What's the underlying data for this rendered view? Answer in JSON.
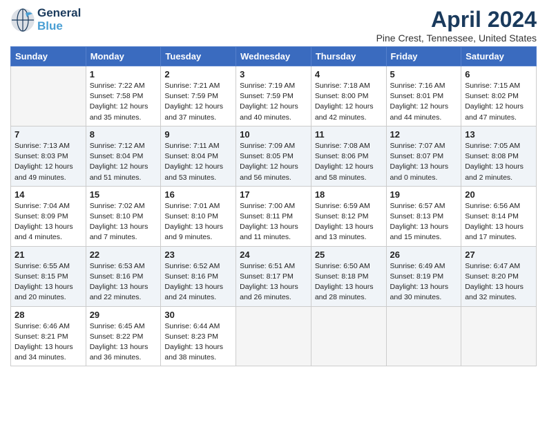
{
  "header": {
    "logo_general": "General",
    "logo_blue": "Blue",
    "month_title": "April 2024",
    "location": "Pine Crest, Tennessee, United States"
  },
  "weekdays": [
    "Sunday",
    "Monday",
    "Tuesday",
    "Wednesday",
    "Thursday",
    "Friday",
    "Saturday"
  ],
  "weeks": [
    [
      {
        "day": "",
        "empty": true
      },
      {
        "day": "1",
        "sunrise": "7:22 AM",
        "sunset": "7:58 PM",
        "daylight": "12 hours and 35 minutes."
      },
      {
        "day": "2",
        "sunrise": "7:21 AM",
        "sunset": "7:59 PM",
        "daylight": "12 hours and 37 minutes."
      },
      {
        "day": "3",
        "sunrise": "7:19 AM",
        "sunset": "7:59 PM",
        "daylight": "12 hours and 40 minutes."
      },
      {
        "day": "4",
        "sunrise": "7:18 AM",
        "sunset": "8:00 PM",
        "daylight": "12 hours and 42 minutes."
      },
      {
        "day": "5",
        "sunrise": "7:16 AM",
        "sunset": "8:01 PM",
        "daylight": "12 hours and 44 minutes."
      },
      {
        "day": "6",
        "sunrise": "7:15 AM",
        "sunset": "8:02 PM",
        "daylight": "12 hours and 47 minutes."
      }
    ],
    [
      {
        "day": "7",
        "sunrise": "7:13 AM",
        "sunset": "8:03 PM",
        "daylight": "12 hours and 49 minutes."
      },
      {
        "day": "8",
        "sunrise": "7:12 AM",
        "sunset": "8:04 PM",
        "daylight": "12 hours and 51 minutes."
      },
      {
        "day": "9",
        "sunrise": "7:11 AM",
        "sunset": "8:04 PM",
        "daylight": "12 hours and 53 minutes."
      },
      {
        "day": "10",
        "sunrise": "7:09 AM",
        "sunset": "8:05 PM",
        "daylight": "12 hours and 56 minutes."
      },
      {
        "day": "11",
        "sunrise": "7:08 AM",
        "sunset": "8:06 PM",
        "daylight": "12 hours and 58 minutes."
      },
      {
        "day": "12",
        "sunrise": "7:07 AM",
        "sunset": "8:07 PM",
        "daylight": "13 hours and 0 minutes."
      },
      {
        "day": "13",
        "sunrise": "7:05 AM",
        "sunset": "8:08 PM",
        "daylight": "13 hours and 2 minutes."
      }
    ],
    [
      {
        "day": "14",
        "sunrise": "7:04 AM",
        "sunset": "8:09 PM",
        "daylight": "13 hours and 4 minutes."
      },
      {
        "day": "15",
        "sunrise": "7:02 AM",
        "sunset": "8:10 PM",
        "daylight": "13 hours and 7 minutes."
      },
      {
        "day": "16",
        "sunrise": "7:01 AM",
        "sunset": "8:10 PM",
        "daylight": "13 hours and 9 minutes."
      },
      {
        "day": "17",
        "sunrise": "7:00 AM",
        "sunset": "8:11 PM",
        "daylight": "13 hours and 11 minutes."
      },
      {
        "day": "18",
        "sunrise": "6:59 AM",
        "sunset": "8:12 PM",
        "daylight": "13 hours and 13 minutes."
      },
      {
        "day": "19",
        "sunrise": "6:57 AM",
        "sunset": "8:13 PM",
        "daylight": "13 hours and 15 minutes."
      },
      {
        "day": "20",
        "sunrise": "6:56 AM",
        "sunset": "8:14 PM",
        "daylight": "13 hours and 17 minutes."
      }
    ],
    [
      {
        "day": "21",
        "sunrise": "6:55 AM",
        "sunset": "8:15 PM",
        "daylight": "13 hours and 20 minutes."
      },
      {
        "day": "22",
        "sunrise": "6:53 AM",
        "sunset": "8:16 PM",
        "daylight": "13 hours and 22 minutes."
      },
      {
        "day": "23",
        "sunrise": "6:52 AM",
        "sunset": "8:16 PM",
        "daylight": "13 hours and 24 minutes."
      },
      {
        "day": "24",
        "sunrise": "6:51 AM",
        "sunset": "8:17 PM",
        "daylight": "13 hours and 26 minutes."
      },
      {
        "day": "25",
        "sunrise": "6:50 AM",
        "sunset": "8:18 PM",
        "daylight": "13 hours and 28 minutes."
      },
      {
        "day": "26",
        "sunrise": "6:49 AM",
        "sunset": "8:19 PM",
        "daylight": "13 hours and 30 minutes."
      },
      {
        "day": "27",
        "sunrise": "6:47 AM",
        "sunset": "8:20 PM",
        "daylight": "13 hours and 32 minutes."
      }
    ],
    [
      {
        "day": "28",
        "sunrise": "6:46 AM",
        "sunset": "8:21 PM",
        "daylight": "13 hours and 34 minutes."
      },
      {
        "day": "29",
        "sunrise": "6:45 AM",
        "sunset": "8:22 PM",
        "daylight": "13 hours and 36 minutes."
      },
      {
        "day": "30",
        "sunrise": "6:44 AM",
        "sunset": "8:23 PM",
        "daylight": "13 hours and 38 minutes."
      },
      {
        "day": "",
        "empty": true
      },
      {
        "day": "",
        "empty": true
      },
      {
        "day": "",
        "empty": true
      },
      {
        "day": "",
        "empty": true
      }
    ]
  ]
}
